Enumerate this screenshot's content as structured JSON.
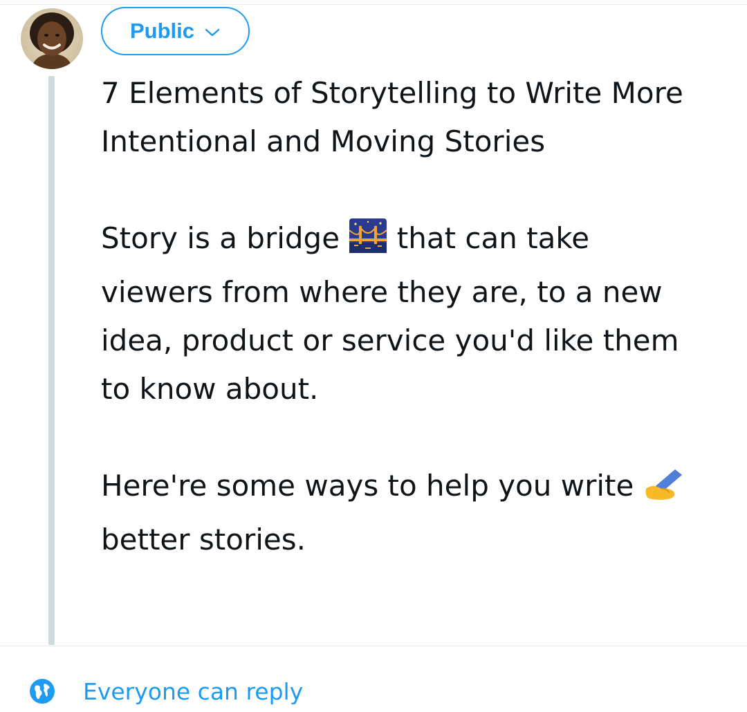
{
  "composer": {
    "audience_label": "Public",
    "audience_icon": "chevron-down-icon",
    "avatar_icon": "user-avatar"
  },
  "tweet": {
    "title_line_1": "7 Elements of Storytelling to Write More",
    "title_line_2": "Intentional and Moving Stories",
    "p1_line_1_a": "Story is a bridge",
    "p1_emoji": "bridge-at-night-emoji",
    "p1_line_1_b": "that can take",
    "p1_line_2": "viewers from where they are, to a new",
    "p1_line_3": "idea, product or service you'd like them",
    "p1_line_4": "to know about.",
    "p2_line_1": "Here're some ways to help you write",
    "p2_emoji": "writing-hand-emoji",
    "p2_line_2": "better stories."
  },
  "reply_setting": {
    "label": "Everyone can reply",
    "icon": "globe-icon"
  },
  "colors": {
    "accent": "#1d9bf0",
    "text": "#0f1419",
    "thread_line": "#cfd9de",
    "divider": "#e6e9eb"
  }
}
